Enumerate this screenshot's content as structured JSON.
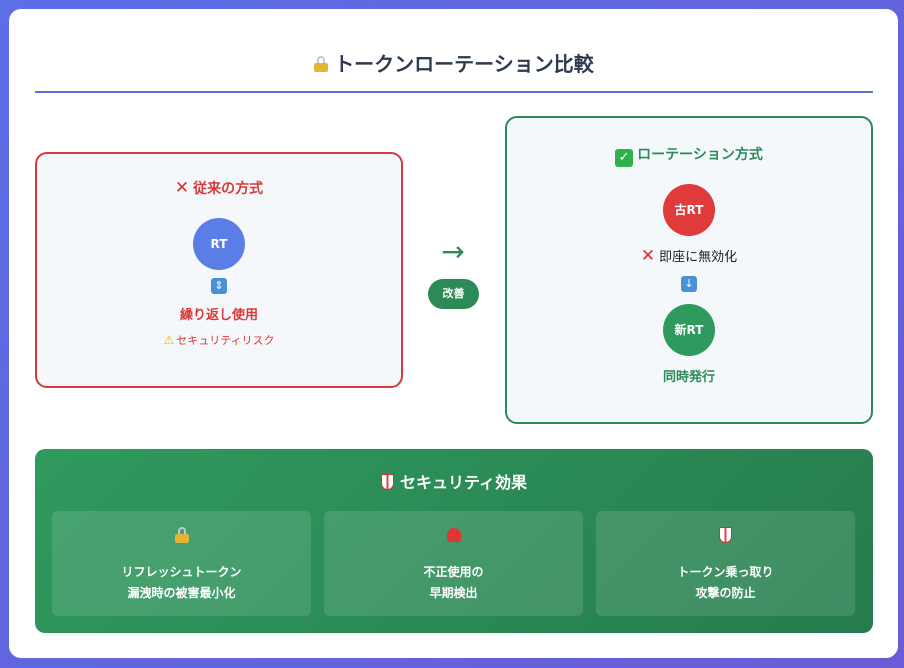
{
  "title": "トークンローテーション比較",
  "old_method": {
    "heading": "従来の方式",
    "token": "RT",
    "reuse_label": "繰り返し使用",
    "risk_label": "セキュリティリスク"
  },
  "transition": {
    "arrow": "→",
    "label": "改善"
  },
  "new_method": {
    "heading": "ローテーション方式",
    "old_token": "古RT",
    "invalidate_label": "即座に無効化",
    "new_token": "新RT",
    "issue_label": "同時発行"
  },
  "effects": {
    "heading": "セキュリティ効果",
    "items": [
      {
        "icon": "lock-icon",
        "line1": "リフレッシュトークン",
        "line2": "漏洩時の被害最小化"
      },
      {
        "icon": "siren-icon",
        "line1": "不正使用の",
        "line2": "早期検出"
      },
      {
        "icon": "shield-icon",
        "line1": "トークン乗っ取り",
        "line2": "攻撃の防止"
      }
    ]
  },
  "colors": {
    "red": "#d63a3a",
    "green": "#2b8a57",
    "blue_circle": "#5b7ee6",
    "red_circle": "#e03b3b",
    "green_circle": "#2f9a5e"
  }
}
